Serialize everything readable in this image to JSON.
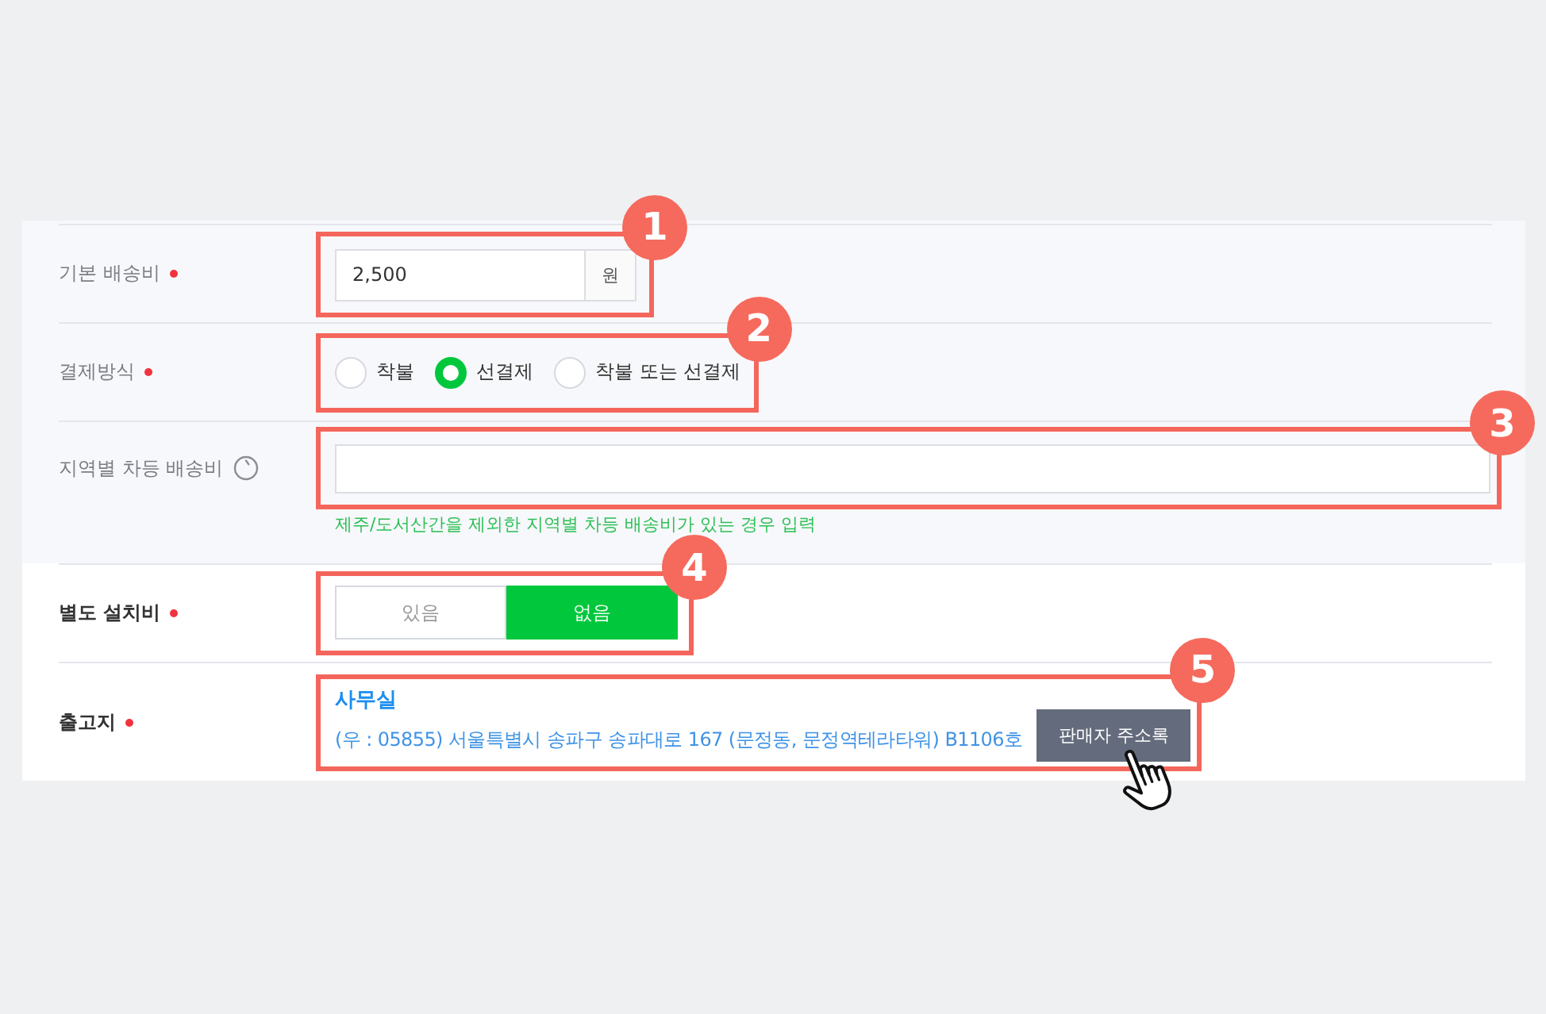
{
  "sections": [
    {
      "shaded": true,
      "rows": [
        {
          "kind": "input-unit",
          "label": "기본 배송비",
          "required": true,
          "step": "1",
          "value": "2,500",
          "unit": "원"
        },
        {
          "kind": "radio",
          "label": "결제방식",
          "required": true,
          "step": "2",
          "options": [
            {
              "label": "착불",
              "selected": false
            },
            {
              "label": "선결제",
              "selected": true
            },
            {
              "label": "착불 또는 선결제",
              "selected": false
            }
          ]
        },
        {
          "kind": "text-input",
          "label": "지역별 차등 배송비",
          "help_icon": true,
          "step": "3",
          "help": "제주/도서산간을 제외한 지역별 차등 배송비가 있는 경우 입력"
        }
      ]
    },
    {
      "shaded": false,
      "rows": [
        {
          "kind": "segmented",
          "label": "별도 설치비",
          "required": true,
          "step": "4",
          "options": [
            {
              "label": "있음",
              "selected": false
            },
            {
              "label": "없음",
              "selected": true
            }
          ]
        },
        {
          "kind": "address",
          "label": "출고지",
          "required": true,
          "step": "5",
          "name": "사무실",
          "address": "(우 : 05855) 서울특별시 송파구 송파대로 167 (문정동, 문정역테라타워) B1106호",
          "button": {
            "label": "판매자 주소록",
            "pointer": true
          }
        }
      ]
    }
  ]
}
